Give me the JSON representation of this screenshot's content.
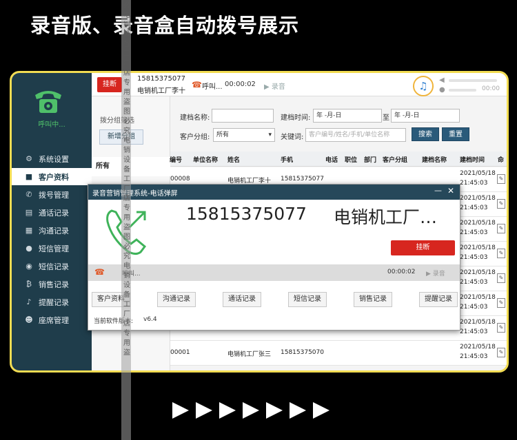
{
  "banner": {
    "title": "录音版、录音盒自动拨号展示"
  },
  "sidebar": {
    "calling_status": "呼叫中...",
    "items": [
      {
        "label": "系统设置",
        "icon": "gear-icon"
      },
      {
        "label": "客户资料",
        "icon": "user-icon",
        "active": true
      },
      {
        "label": "拨号管理",
        "icon": "phone-icon"
      },
      {
        "label": "通话记录",
        "icon": "file-icon"
      },
      {
        "label": "沟通记录",
        "icon": "chat-log-icon"
      },
      {
        "label": "短信管理",
        "icon": "message-icon"
      },
      {
        "label": "短信记录",
        "icon": "message-log-icon"
      },
      {
        "label": "销售记录",
        "icon": "sales-icon"
      },
      {
        "label": "提醒记录",
        "icon": "bell-icon"
      },
      {
        "label": "座席管理",
        "icon": "agents-icon"
      }
    ]
  },
  "topbar": {
    "hangup_label": "挂断",
    "phone": "15815375077",
    "name": "电销机工厂李十",
    "status": "呼叫...",
    "timer": "00:00:02",
    "record_label": "▶ 录音",
    "mic_time": "00:00"
  },
  "groups": {
    "title": "拨分组筛选",
    "new_group_label": "新增分组",
    "all_label": "所有"
  },
  "filters": {
    "archive_name_label": "建档名称:",
    "archive_time_label": "建档时间:",
    "date_from": "年 -月-日",
    "to_label": "至",
    "date_to": "年 -月-日",
    "customer_group_label": "客户分组:",
    "customer_group_value": "所有",
    "keyword_label": "关键词:",
    "keyword_placeholder": "客户编号/姓名/手机/单位名称",
    "search_label": "搜索",
    "reset_label": "重置"
  },
  "table": {
    "headers": [
      "编号",
      "单位名称",
      "姓名",
      "手机",
      "电话",
      "职位",
      "部门",
      "客户分组",
      "建档名称",
      "建档时间",
      "命"
    ],
    "rows": [
      {
        "id": "00008",
        "name": "电销机工厂李十",
        "mobile": "15815375077",
        "date": "2021/05/18",
        "time": "21:45:03"
      },
      {
        "id": "",
        "name": "",
        "mobile": "",
        "date": "2021/05/18",
        "time": "21:45:03"
      },
      {
        "id": "",
        "name": "",
        "mobile": "",
        "date": "2021/05/18",
        "time": "21:45:03"
      },
      {
        "id": "",
        "name": "",
        "mobile": "",
        "date": "2021/05/18",
        "time": "21:45:03"
      },
      {
        "id": "",
        "name": "",
        "mobile": "",
        "date": "2021/05/18",
        "time": "21:45:03"
      },
      {
        "id": "",
        "name": "",
        "mobile": "",
        "date": "2021/05/18",
        "time": "21:45:03"
      },
      {
        "id": "",
        "name": "",
        "mobile": "",
        "date": "2021/05/18",
        "time": "21:45:03"
      },
      {
        "id": "00001",
        "name": "电销机工厂张三",
        "mobile": "15815375070",
        "date": "2021/05/18",
        "time": "21:45:03"
      }
    ]
  },
  "popup": {
    "title": "录音营销管理系统-电话弹屏",
    "phone": "15815375077",
    "name": "电销机工厂…",
    "hangup_label": "挂断",
    "status": "呼叫...",
    "timer": "00:00:02",
    "record_label": "▶ 录音",
    "buttons": [
      "客户资料",
      "沟通记录",
      "通话记录",
      "短信记录",
      "销售记录",
      "提醒记录"
    ],
    "version_label": "当前软件版本:",
    "version": "v6.4"
  },
  "watermark": {
    "text": "必电销设备工厂店专用盗图必究电销设备工厂店专用盗图必究电销设备工厂店专用盗"
  },
  "colors": {
    "sidebar": "#1f3d4b",
    "hangup": "#d7261f",
    "frame": "#f2dc52",
    "accent_green": "#4fc06a"
  }
}
